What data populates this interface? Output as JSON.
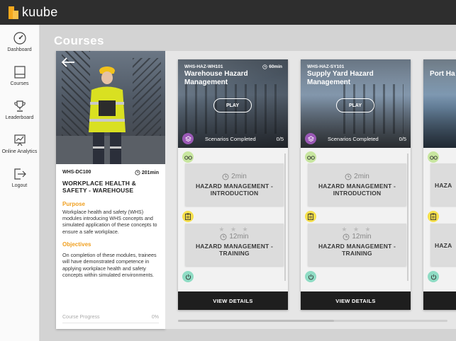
{
  "app": {
    "logo_text": "kuube",
    "brand_color": "#f4a81d"
  },
  "sidebar": {
    "items": [
      {
        "label": "Dashboard",
        "icon": "gauge-icon"
      },
      {
        "label": "Courses",
        "icon": "book-icon"
      },
      {
        "label": "Leaderboard",
        "icon": "trophy-icon"
      },
      {
        "label": "Online Analytics",
        "icon": "chart-icon"
      },
      {
        "label": "Logout",
        "icon": "logout-icon"
      }
    ]
  },
  "page": {
    "title": "Courses"
  },
  "course": {
    "code": "WHS-DC100",
    "duration": "201min",
    "title": "WORKPLACE HEALTH & SAFETY - WAREHOUSE",
    "purpose_heading": "Purpose",
    "purpose_text": "Workplace health and safety (WHS) modules introducing WHS concepts and simulated application of these concepts to ensure a safe workplace.",
    "objectives_heading": "Objectives",
    "objectives_text": "On completion of these modules, trainees will have demonstrated competence in applying workplace health and safety concepts within simulated environments.",
    "progress_label": "Course Progress",
    "progress_value": "0%"
  },
  "modules": [
    {
      "code": "WHS-HAZ-WH101",
      "duration": "60min",
      "title": "Warehouse Hazard Management",
      "play_label": "PLAY",
      "scenarios_label": "Scenarios Completed",
      "scenarios_count": "0/5",
      "scenarios": [
        {
          "duration": "2min",
          "name": "HAZARD MANAGEMENT - INTRODUCTION",
          "stars": "",
          "tag": "glasses-icon"
        },
        {
          "duration": "12min",
          "name": "HAZARD MANAGEMENT - TRAINING",
          "stars": "★ ★ ★",
          "tag": "clipboard-icon"
        }
      ],
      "view_label": "VIEW DETAILS"
    },
    {
      "code": "WHS-HAZ-SY101",
      "duration": "",
      "title": "Supply Yard Hazard Management",
      "play_label": "PLAY",
      "scenarios_label": "Scenarios Completed",
      "scenarios_count": "0/5",
      "scenarios": [
        {
          "duration": "2min",
          "name": "HAZARD MANAGEMENT - INTRODUCTION",
          "stars": "",
          "tag": "glasses-icon"
        },
        {
          "duration": "12min",
          "name": "HAZARD MANAGEMENT - TRAINING",
          "stars": "★ ★ ★",
          "tag": "clipboard-icon"
        }
      ],
      "view_label": "VIEW DETAILS"
    },
    {
      "code": "",
      "duration": "",
      "title": "Port Ha",
      "play_label": "",
      "scenarios_label": "",
      "scenarios_count": "",
      "scenarios": [
        {
          "duration": "",
          "name": "HAZA",
          "stars": "",
          "tag": "glasses-icon"
        },
        {
          "duration": "",
          "name": "HAZA",
          "stars": "",
          "tag": "clipboard-icon"
        }
      ],
      "view_label": ""
    }
  ]
}
